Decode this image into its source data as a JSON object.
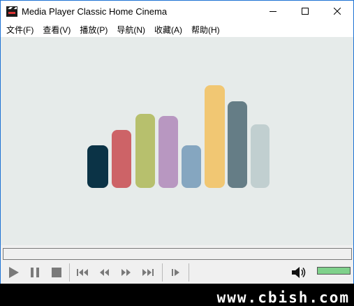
{
  "window": {
    "title": "Media Player Classic Home Cinema"
  },
  "menu": [
    {
      "label": "文件(F)"
    },
    {
      "label": "查看(V)"
    },
    {
      "label": "播放(P)"
    },
    {
      "label": "导航(N)"
    },
    {
      "label": "收藏(A)"
    },
    {
      "label": "帮助(H)"
    }
  ],
  "logo_bars": [
    {
      "color": "#0b3346"
    },
    {
      "color": "#cd6367"
    },
    {
      "color": "#b7c06d"
    },
    {
      "color": "#b897c1"
    },
    {
      "color": "#85a6c0"
    },
    {
      "color": "#f1c773"
    },
    {
      "color": "#657d86"
    },
    {
      "color": "#c1cfd0"
    }
  ],
  "controls": {
    "icons": [
      "play-icon",
      "pause-icon",
      "stop-icon",
      "skip-back-icon",
      "rewind-icon",
      "fast-forward-icon",
      "skip-forward-icon",
      "frame-step-icon",
      "volume-icon"
    ],
    "volume_level": 1.0,
    "volume_color": "#7fd18b"
  },
  "watermark": {
    "text": "www.cbish.com"
  }
}
